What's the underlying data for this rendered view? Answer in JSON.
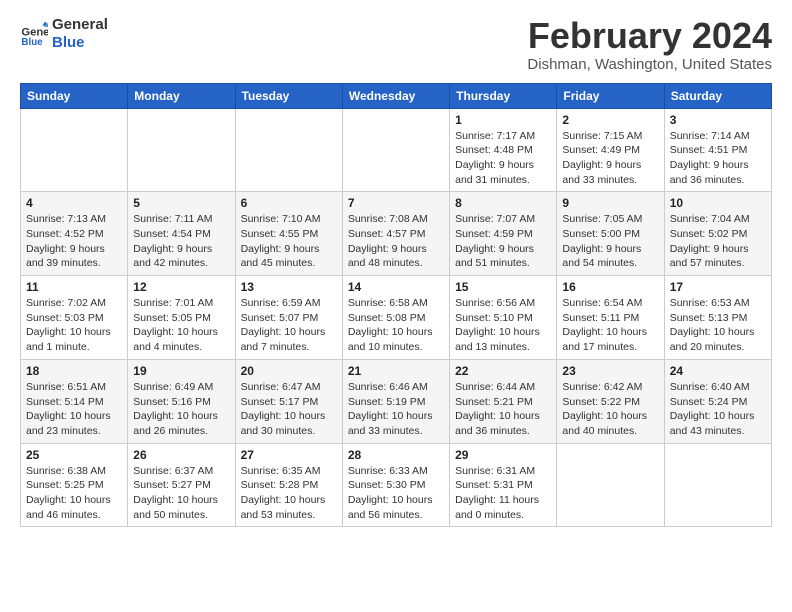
{
  "header": {
    "logo_line1": "General",
    "logo_line2": "Blue",
    "month_year": "February 2024",
    "location": "Dishman, Washington, United States"
  },
  "weekdays": [
    "Sunday",
    "Monday",
    "Tuesday",
    "Wednesday",
    "Thursday",
    "Friday",
    "Saturday"
  ],
  "weeks": [
    [
      {
        "day": "",
        "info": ""
      },
      {
        "day": "",
        "info": ""
      },
      {
        "day": "",
        "info": ""
      },
      {
        "day": "",
        "info": ""
      },
      {
        "day": "1",
        "info": "Sunrise: 7:17 AM\nSunset: 4:48 PM\nDaylight: 9 hours\nand 31 minutes."
      },
      {
        "day": "2",
        "info": "Sunrise: 7:15 AM\nSunset: 4:49 PM\nDaylight: 9 hours\nand 33 minutes."
      },
      {
        "day": "3",
        "info": "Sunrise: 7:14 AM\nSunset: 4:51 PM\nDaylight: 9 hours\nand 36 minutes."
      }
    ],
    [
      {
        "day": "4",
        "info": "Sunrise: 7:13 AM\nSunset: 4:52 PM\nDaylight: 9 hours\nand 39 minutes."
      },
      {
        "day": "5",
        "info": "Sunrise: 7:11 AM\nSunset: 4:54 PM\nDaylight: 9 hours\nand 42 minutes."
      },
      {
        "day": "6",
        "info": "Sunrise: 7:10 AM\nSunset: 4:55 PM\nDaylight: 9 hours\nand 45 minutes."
      },
      {
        "day": "7",
        "info": "Sunrise: 7:08 AM\nSunset: 4:57 PM\nDaylight: 9 hours\nand 48 minutes."
      },
      {
        "day": "8",
        "info": "Sunrise: 7:07 AM\nSunset: 4:59 PM\nDaylight: 9 hours\nand 51 minutes."
      },
      {
        "day": "9",
        "info": "Sunrise: 7:05 AM\nSunset: 5:00 PM\nDaylight: 9 hours\nand 54 minutes."
      },
      {
        "day": "10",
        "info": "Sunrise: 7:04 AM\nSunset: 5:02 PM\nDaylight: 9 hours\nand 57 minutes."
      }
    ],
    [
      {
        "day": "11",
        "info": "Sunrise: 7:02 AM\nSunset: 5:03 PM\nDaylight: 10 hours\nand 1 minute."
      },
      {
        "day": "12",
        "info": "Sunrise: 7:01 AM\nSunset: 5:05 PM\nDaylight: 10 hours\nand 4 minutes."
      },
      {
        "day": "13",
        "info": "Sunrise: 6:59 AM\nSunset: 5:07 PM\nDaylight: 10 hours\nand 7 minutes."
      },
      {
        "day": "14",
        "info": "Sunrise: 6:58 AM\nSunset: 5:08 PM\nDaylight: 10 hours\nand 10 minutes."
      },
      {
        "day": "15",
        "info": "Sunrise: 6:56 AM\nSunset: 5:10 PM\nDaylight: 10 hours\nand 13 minutes."
      },
      {
        "day": "16",
        "info": "Sunrise: 6:54 AM\nSunset: 5:11 PM\nDaylight: 10 hours\nand 17 minutes."
      },
      {
        "day": "17",
        "info": "Sunrise: 6:53 AM\nSunset: 5:13 PM\nDaylight: 10 hours\nand 20 minutes."
      }
    ],
    [
      {
        "day": "18",
        "info": "Sunrise: 6:51 AM\nSunset: 5:14 PM\nDaylight: 10 hours\nand 23 minutes."
      },
      {
        "day": "19",
        "info": "Sunrise: 6:49 AM\nSunset: 5:16 PM\nDaylight: 10 hours\nand 26 minutes."
      },
      {
        "day": "20",
        "info": "Sunrise: 6:47 AM\nSunset: 5:17 PM\nDaylight: 10 hours\nand 30 minutes."
      },
      {
        "day": "21",
        "info": "Sunrise: 6:46 AM\nSunset: 5:19 PM\nDaylight: 10 hours\nand 33 minutes."
      },
      {
        "day": "22",
        "info": "Sunrise: 6:44 AM\nSunset: 5:21 PM\nDaylight: 10 hours\nand 36 minutes."
      },
      {
        "day": "23",
        "info": "Sunrise: 6:42 AM\nSunset: 5:22 PM\nDaylight: 10 hours\nand 40 minutes."
      },
      {
        "day": "24",
        "info": "Sunrise: 6:40 AM\nSunset: 5:24 PM\nDaylight: 10 hours\nand 43 minutes."
      }
    ],
    [
      {
        "day": "25",
        "info": "Sunrise: 6:38 AM\nSunset: 5:25 PM\nDaylight: 10 hours\nand 46 minutes."
      },
      {
        "day": "26",
        "info": "Sunrise: 6:37 AM\nSunset: 5:27 PM\nDaylight: 10 hours\nand 50 minutes."
      },
      {
        "day": "27",
        "info": "Sunrise: 6:35 AM\nSunset: 5:28 PM\nDaylight: 10 hours\nand 53 minutes."
      },
      {
        "day": "28",
        "info": "Sunrise: 6:33 AM\nSunset: 5:30 PM\nDaylight: 10 hours\nand 56 minutes."
      },
      {
        "day": "29",
        "info": "Sunrise: 6:31 AM\nSunset: 5:31 PM\nDaylight: 11 hours\nand 0 minutes."
      },
      {
        "day": "",
        "info": ""
      },
      {
        "day": "",
        "info": ""
      }
    ]
  ]
}
